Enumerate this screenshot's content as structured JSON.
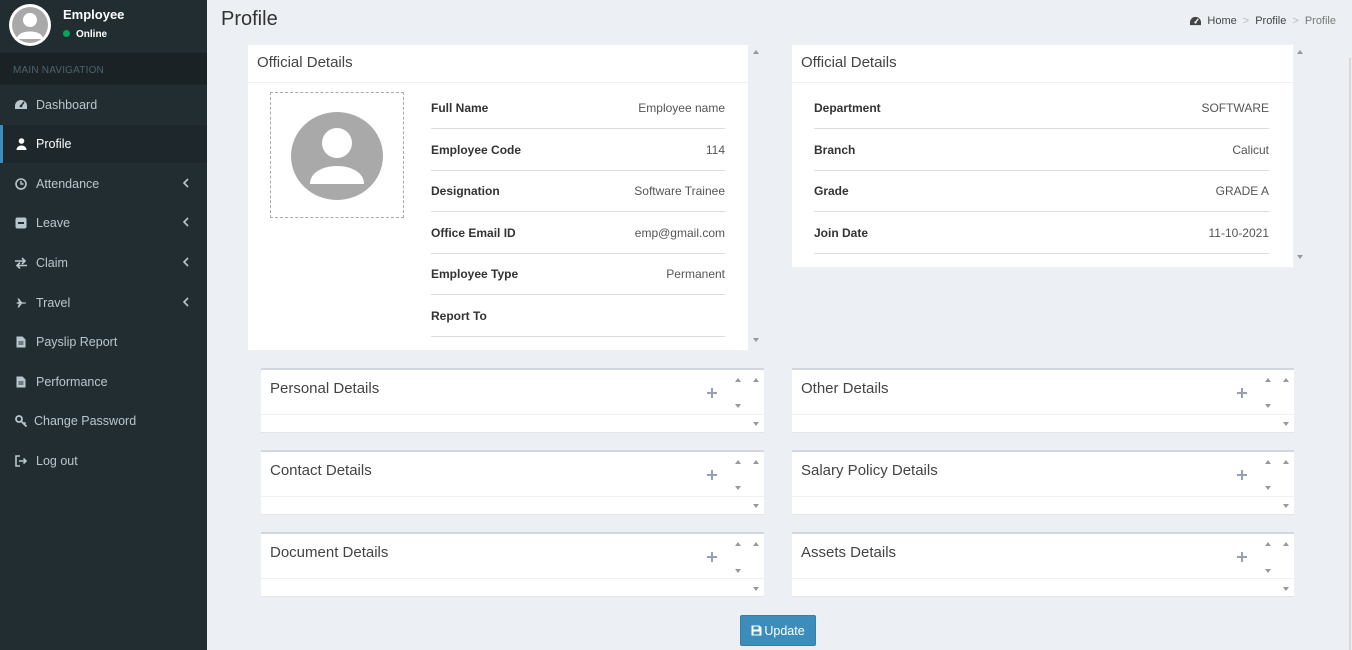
{
  "user": {
    "name": "Employee",
    "status": "Online"
  },
  "nav": {
    "header": "MAIN NAVIGATION",
    "items": [
      {
        "label": "Dashboard",
        "icon": "dashboard-icon",
        "has_submenu": false
      },
      {
        "label": "Profile",
        "icon": "user-icon",
        "has_submenu": false,
        "active": true
      },
      {
        "label": "Attendance",
        "icon": "clock-icon",
        "has_submenu": true
      },
      {
        "label": "Leave",
        "icon": "minus-square-icon",
        "has_submenu": true
      },
      {
        "label": "Claim",
        "icon": "exchange-icon",
        "has_submenu": true
      },
      {
        "label": "Travel",
        "icon": "plane-icon",
        "has_submenu": true
      },
      {
        "label": "Payslip Report",
        "icon": "file-icon",
        "has_submenu": false
      },
      {
        "label": "Performance",
        "icon": "file-icon",
        "has_submenu": false
      },
      {
        "label": "Change Password",
        "icon": "key-icon",
        "has_submenu": false
      },
      {
        "label": "Log out",
        "icon": "sign-out-icon",
        "has_submenu": false
      }
    ]
  },
  "page": {
    "title": "Profile",
    "breadcrumb": {
      "home": "Home",
      "section": "Profile",
      "current": "Profile"
    }
  },
  "official_left": {
    "title": "Official Details",
    "rows": [
      {
        "label": "Full Name",
        "value": "Employee name"
      },
      {
        "label": "Employee Code",
        "value": "114"
      },
      {
        "label": "Designation",
        "value": "Software Trainee"
      },
      {
        "label": "Office Email ID",
        "value": "emp@gmail.com"
      },
      {
        "label": "Employee Type",
        "value": "Permanent"
      },
      {
        "label": "Report To",
        "value": ""
      }
    ]
  },
  "official_right": {
    "title": "Official Details",
    "rows": [
      {
        "label": "Department",
        "value": "SOFTWARE"
      },
      {
        "label": "Branch",
        "value": "Calicut"
      },
      {
        "label": "Grade",
        "value": "GRADE A"
      },
      {
        "label": "Join Date",
        "value": "11-10-2021"
      }
    ]
  },
  "sections": {
    "personal": "Personal Details",
    "other": "Other Details",
    "contact": "Contact Details",
    "salary": "Salary Policy Details",
    "document": "Document Details",
    "assets": "Assets Details"
  },
  "actions": {
    "update": "Update"
  },
  "colors": {
    "sidebar": "#222d32",
    "accent": "#3c8dbc",
    "online": "#00a65a",
    "background": "#ecf0f5"
  }
}
